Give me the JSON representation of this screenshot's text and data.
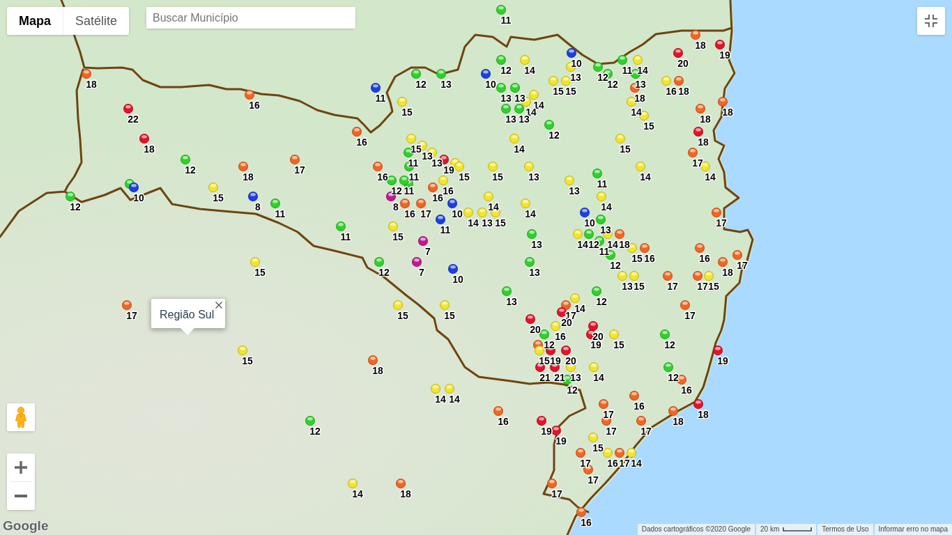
{
  "map_type_control": [
    {
      "label": "Mapa",
      "selected": true
    },
    {
      "label": "Satélite",
      "selected": false
    }
  ],
  "search": {
    "placeholder": "Buscar Município"
  },
  "info_window": {
    "title": "Região Sul"
  },
  "markers": [
    {
      "label": "11",
      "color": "#2fd12a"
    },
    {
      "label": "18",
      "color": "#f26522"
    },
    {
      "label": "19",
      "color": "#e3132b"
    },
    {
      "label": "10",
      "color": "#1c3fe3"
    },
    {
      "label": "20",
      "color": "#e3132b"
    },
    {
      "label": "12",
      "color": "#2fd12a"
    },
    {
      "label": "14",
      "color": "#f2e52a"
    },
    {
      "label": "11",
      "color": "#2fd12a"
    },
    {
      "label": "14",
      "color": "#f2e52a"
    },
    {
      "label": "13",
      "color": "#f2e52a"
    },
    {
      "label": "12",
      "color": "#2fd12a"
    },
    {
      "label": "18",
      "color": "#f26522"
    },
    {
      "label": "12",
      "color": "#2fd12a"
    },
    {
      "label": "13",
      "color": "#2fd12a"
    },
    {
      "label": "10",
      "color": "#1c3fe3"
    },
    {
      "label": "12",
      "color": "#2fd12a"
    },
    {
      "label": "13",
      "color": "#2fd12a"
    },
    {
      "label": "15",
      "color": "#f2e52a"
    },
    {
      "label": "15",
      "color": "#f2e52a"
    },
    {
      "label": "16",
      "color": "#f2e52a"
    },
    {
      "label": "18",
      "color": "#f26522"
    },
    {
      "label": "11",
      "color": "#1c3fe3"
    },
    {
      "label": "13",
      "color": "#2fd12a"
    },
    {
      "label": "13",
      "color": "#2fd12a"
    },
    {
      "label": "18",
      "color": "#f26522"
    },
    {
      "label": "16",
      "color": "#f26522"
    },
    {
      "label": "14",
      "color": "#f2e52a"
    },
    {
      "label": "15",
      "color": "#f2e52a"
    },
    {
      "label": "14",
      "color": "#f2e52a"
    },
    {
      "label": "14",
      "color": "#f2e52a"
    },
    {
      "label": "18",
      "color": "#f26522"
    },
    {
      "label": "22",
      "color": "#e3132b"
    },
    {
      "label": "13",
      "color": "#2fd12a"
    },
    {
      "label": "13",
      "color": "#2fd12a"
    },
    {
      "label": "18",
      "color": "#f26522"
    },
    {
      "label": "15",
      "color": "#f2e52a"
    },
    {
      "label": "12",
      "color": "#2fd12a"
    },
    {
      "label": "16",
      "color": "#f26522"
    },
    {
      "label": "18",
      "color": "#e3132b"
    },
    {
      "label": "18",
      "color": "#e3132b"
    },
    {
      "label": "15",
      "color": "#f2e52a"
    },
    {
      "label": "14",
      "color": "#f2e52a"
    },
    {
      "label": "15",
      "color": "#f2e52a"
    },
    {
      "label": "13",
      "color": "#f2e52a"
    },
    {
      "label": "11",
      "color": "#2fd12a"
    },
    {
      "label": "13",
      "color": "#f2e52a"
    },
    {
      "color": "#f2e52a"
    },
    {
      "label": "17",
      "color": "#f26522"
    },
    {
      "label": "12",
      "color": "#2fd12a"
    },
    {
      "label": "17",
      "color": "#f26522"
    },
    {
      "label": "19",
      "color": "#e3132b"
    },
    {
      "label": "18",
      "color": "#f26522"
    },
    {
      "label": "16",
      "color": "#f26522"
    },
    {
      "label": "11",
      "color": "#2fd12a"
    },
    {
      "label": "15",
      "color": "#f2e52a"
    },
    {
      "label": "15",
      "color": "#f2e52a"
    },
    {
      "label": "13",
      "color": "#f2e52a"
    },
    {
      "label": "14",
      "color": "#f2e52a"
    },
    {
      "label": "14",
      "color": "#f2e52a"
    },
    {
      "color": "#2fd12a"
    },
    {
      "color": "#2fd12a"
    },
    {
      "label": "11",
      "color": "#2fd12a"
    },
    {
      "label": "12",
      "color": "#2fd12a"
    },
    {
      "label": "11",
      "color": "#2fd12a"
    },
    {
      "label": "16",
      "color": "#f2e52a"
    },
    {
      "label": "13",
      "color": "#f2e52a"
    },
    {
      "label": "10",
      "color": "#1c3fe3"
    },
    {
      "label": "15",
      "color": "#f2e52a"
    },
    {
      "label": "16",
      "color": "#f26522"
    },
    {
      "label": "12",
      "color": "#2fd12a"
    },
    {
      "label": "8",
      "color": "#1c3fe3"
    },
    {
      "label": "8",
      "color": "#c2198f"
    },
    {
      "label": "14",
      "color": "#f2e52a"
    },
    {
      "label": "14",
      "color": "#f2e52a"
    },
    {
      "label": "11",
      "color": "#2fd12a"
    },
    {
      "label": "16",
      "color": "#f26522"
    },
    {
      "label": "17",
      "color": "#f26522"
    },
    {
      "label": "10",
      "color": "#1c3fe3"
    },
    {
      "label": "14",
      "color": "#f2e52a"
    },
    {
      "label": "14",
      "color": "#f2e52a"
    },
    {
      "label": "13",
      "color": "#f2e52a"
    },
    {
      "label": "15",
      "color": "#f2e52a"
    },
    {
      "label": "10",
      "color": "#1c3fe3"
    },
    {
      "label": "17",
      "color": "#f26522"
    },
    {
      "label": "11",
      "color": "#1c3fe3"
    },
    {
      "label": "13",
      "color": "#2fd12a"
    },
    {
      "label": "11",
      "color": "#2fd12a"
    },
    {
      "label": "15",
      "color": "#f2e52a"
    },
    {
      "label": "13",
      "color": "#2fd12a"
    },
    {
      "label": "14",
      "color": "#f2e52a"
    },
    {
      "label": "12",
      "color": "#2fd12a"
    },
    {
      "label": "14",
      "color": "#f2e52a"
    },
    {
      "label": "18",
      "color": "#f26522"
    },
    {
      "label": "7",
      "color": "#c2198f"
    },
    {
      "label": "11",
      "color": "#2fd12a"
    },
    {
      "label": "15",
      "color": "#f2e52a"
    },
    {
      "label": "16",
      "color": "#f26522"
    },
    {
      "label": "16",
      "color": "#f26522"
    },
    {
      "label": "12",
      "color": "#2fd12a"
    },
    {
      "label": "17",
      "color": "#f26522"
    },
    {
      "label": "15",
      "color": "#f2e52a"
    },
    {
      "label": "12",
      "color": "#2fd12a"
    },
    {
      "label": "7",
      "color": "#c2198f"
    },
    {
      "label": "13",
      "color": "#2fd12a"
    },
    {
      "label": "18",
      "color": "#f26522"
    },
    {
      "label": "10",
      "color": "#1c3fe3"
    },
    {
      "label": "13",
      "color": "#f2e52a"
    },
    {
      "label": "15",
      "color": "#f2e52a"
    },
    {
      "label": "17",
      "color": "#f26522"
    },
    {
      "label": "17",
      "color": "#f26522"
    },
    {
      "label": "15",
      "color": "#f2e52a"
    },
    {
      "label": "13",
      "color": "#2fd12a"
    },
    {
      "label": "12",
      "color": "#2fd12a"
    },
    {
      "label": "14",
      "color": "#f2e52a"
    },
    {
      "label": "17",
      "color": "#f26522"
    },
    {
      "label": "15",
      "color": "#f2e52a"
    },
    {
      "label": "15",
      "color": "#f2e52a"
    },
    {
      "label": "17",
      "color": "#f26522"
    },
    {
      "label": "17",
      "color": "#f26522"
    },
    {
      "label": "20",
      "color": "#e3132b"
    },
    {
      "label": "20",
      "color": "#e3132b"
    },
    {
      "label": "16",
      "color": "#f2e52a"
    },
    {
      "label": "20",
      "color": "#e3132b"
    },
    {
      "color": "#f26522"
    },
    {
      "label": "12",
      "color": "#2fd12a"
    },
    {
      "label": "19",
      "color": "#e3132b"
    },
    {
      "label": "15",
      "color": "#f2e52a"
    },
    {
      "label": "12",
      "color": "#2fd12a"
    },
    {
      "label": "15",
      "color": "#f2e52a"
    },
    {
      "label": "15",
      "color": "#f2e52a"
    },
    {
      "label": "19",
      "color": "#e3132b"
    },
    {
      "label": "20",
      "color": "#e3132b"
    },
    {
      "label": "19",
      "color": "#e3132b"
    },
    {
      "label": "18",
      "color": "#f26522"
    },
    {
      "label": "21",
      "color": "#e3132b"
    },
    {
      "label": "21",
      "color": "#e3132b"
    },
    {
      "label": "13",
      "color": "#f2e52a"
    },
    {
      "label": "14",
      "color": "#f2e52a"
    },
    {
      "label": "12",
      "color": "#2fd12a"
    },
    {
      "label": "12",
      "color": "#2fd12a"
    },
    {
      "label": "16",
      "color": "#f26522"
    },
    {
      "label": "14",
      "color": "#f2e52a"
    },
    {
      "label": "14",
      "color": "#f2e52a"
    },
    {
      "label": "16",
      "color": "#f26522"
    },
    {
      "label": "17",
      "color": "#f26522"
    },
    {
      "label": "18",
      "color": "#e3132b"
    },
    {
      "label": "16",
      "color": "#f26522"
    },
    {
      "label": "18",
      "color": "#f26522"
    },
    {
      "label": "12",
      "color": "#2fd12a"
    },
    {
      "label": "19",
      "color": "#e3132b"
    },
    {
      "label": "17",
      "color": "#f26522"
    },
    {
      "label": "17",
      "color": "#f26522"
    },
    {
      "label": "19",
      "color": "#e3132b"
    },
    {
      "label": "15",
      "color": "#f2e52a"
    },
    {
      "label": "17",
      "color": "#f26522"
    },
    {
      "label": "16",
      "color": "#f2e52a"
    },
    {
      "label": "17",
      "color": "#f26522"
    },
    {
      "label": "14",
      "color": "#f2e52a"
    },
    {
      "label": "17",
      "color": "#f26522"
    },
    {
      "label": "14",
      "color": "#f2e52a"
    },
    {
      "label": "18",
      "color": "#f26522"
    },
    {
      "label": "17",
      "color": "#f26522"
    },
    {
      "label": "16",
      "color": "#f26522"
    }
  ],
  "logo": "Google",
  "attribution": {
    "map_data": "Dados cartográficos ©2020 Google",
    "scale": "20 km",
    "terms": "Termos de Uso",
    "report": "Informar erro no mapa"
  }
}
